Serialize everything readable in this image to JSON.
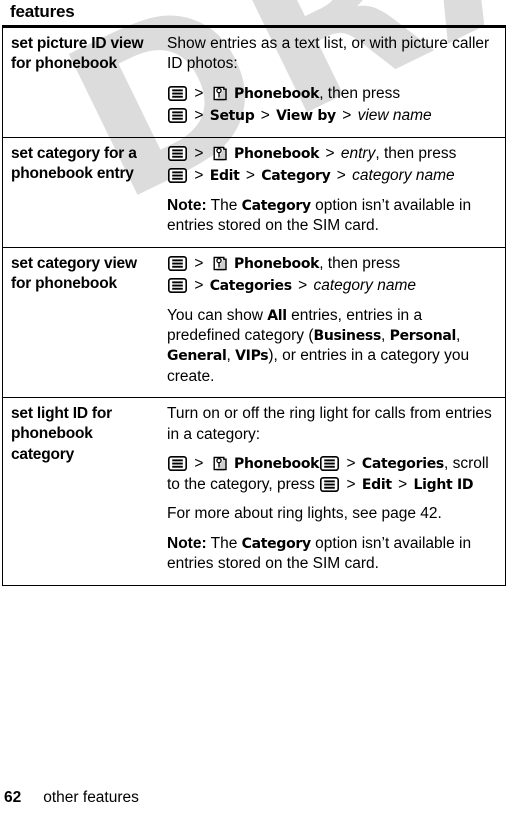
{
  "watermark": {
    "text": "DRAFT"
  },
  "table": {
    "header": "features",
    "rows": [
      {
        "term": "set picture ID view for phonebook",
        "blocks": [
          {
            "kind": "text",
            "text": "Show entries as a text list, or with picture caller ID photos:"
          },
          {
            "kind": "path",
            "line1": {
              "menu": "menu-icon",
              "gt1": ">",
              "pb": "phonebook-icon",
              "label": "Phonebook",
              "tail": ", then press"
            },
            "line2": {
              "menu": "menu-icon",
              "gt1": ">",
              "item1": "Setup",
              "gt2": ">",
              "item2": "View by",
              "gt3": ">",
              "italic": "view name"
            }
          }
        ]
      },
      {
        "term": "set category for a phonebook entry",
        "blocks": [
          {
            "kind": "path",
            "line1": {
              "menu": "menu-icon",
              "gt1": ">",
              "pb": "phonebook-icon",
              "label": "Phonebook",
              "gt2": ">",
              "italic": "entry",
              "tail": ", then press"
            },
            "line2": {
              "menu": "menu-icon",
              "gt1": ">",
              "item1": "Edit",
              "gt2": ">",
              "item2": "Category",
              "gt3": ">",
              "italic": "category name"
            }
          },
          {
            "kind": "note",
            "note_label": "Note:",
            "pre": " The ",
            "bold": "Category",
            "post": " option isn’t available in entries stored on the SIM card."
          }
        ]
      },
      {
        "term": "set category view for phonebook",
        "blocks": [
          {
            "kind": "path",
            "line1": {
              "menu": "menu-icon",
              "gt1": ">",
              "pb": "phonebook-icon",
              "label": "Phonebook",
              "tail": ", then press"
            },
            "line2": {
              "menu": "menu-icon",
              "gt1": ">",
              "item1": "Categories",
              "gt2": ">",
              "italic": "category name"
            }
          },
          {
            "kind": "rich",
            "s1": "You can show ",
            "b1": "All",
            "s2": " entries, entries in a predefined category (",
            "b2": "Business",
            "s3": ", ",
            "b3": "Personal",
            "s4": ", ",
            "b4": "General",
            "s5": ", ",
            "b5": "VIPs",
            "s6": "), or entries in a category you create."
          }
        ]
      },
      {
        "term": "set light ID for phonebook category",
        "blocks": [
          {
            "kind": "text",
            "text": "Turn on or off the ring light for calls from entries in a category:"
          },
          {
            "kind": "path2",
            "menu1": "menu-icon",
            "gt1": ">",
            "pb": "phonebook-icon",
            "label": "Phonebook",
            "menu2": "menu-icon",
            "gt2": ">",
            "item1": "Categories",
            "mid": ", scroll to the category, press ",
            "menu3": "menu-icon",
            "gt3": ">",
            "item2": "Edit",
            "gt4": ">",
            "item3": "Light ID"
          },
          {
            "kind": "text",
            "text": "For more about ring lights, see page 42."
          },
          {
            "kind": "note",
            "note_label": "Note:",
            "pre": " The ",
            "bold": "Category",
            "post": " option isn’t available in entries stored on the SIM card."
          }
        ]
      }
    ]
  },
  "footer": {
    "page_number": "62",
    "section_title": "other features"
  }
}
